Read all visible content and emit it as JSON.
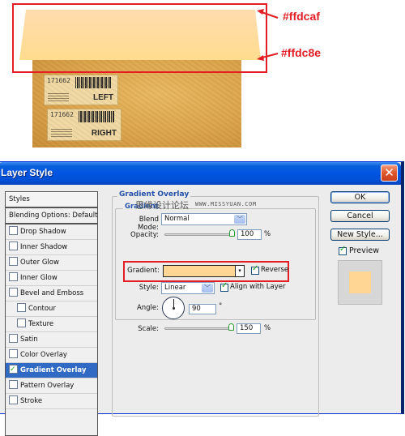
{
  "illustration": {
    "box_labels": {
      "left": {
        "code": "171662",
        "word": "LEFT"
      },
      "right": {
        "code": "171662",
        "word": "RIGHT"
      }
    },
    "annotations": [
      {
        "text": "#ffdcaf",
        "color": "#ffdcaf"
      },
      {
        "text": "#ffdc8e",
        "color": "#ffdc8e"
      }
    ],
    "highlight_color": "#e31e24"
  },
  "dialog": {
    "title": "Layer Style",
    "close_icon": "close-x-icon",
    "styles_panel": {
      "header": "Styles",
      "blending_options": "Blending Options: Default",
      "items": [
        {
          "label": "Drop Shadow",
          "checked": false,
          "indent": false,
          "selected": false
        },
        {
          "label": "Inner Shadow",
          "checked": false,
          "indent": false,
          "selected": false
        },
        {
          "label": "Outer Glow",
          "checked": false,
          "indent": false,
          "selected": false
        },
        {
          "label": "Inner Glow",
          "checked": false,
          "indent": false,
          "selected": false
        },
        {
          "label": "Bevel and Emboss",
          "checked": false,
          "indent": false,
          "selected": false
        },
        {
          "label": "Contour",
          "checked": false,
          "indent": true,
          "selected": false
        },
        {
          "label": "Texture",
          "checked": false,
          "indent": true,
          "selected": false
        },
        {
          "label": "Satin",
          "checked": false,
          "indent": false,
          "selected": false
        },
        {
          "label": "Color Overlay",
          "checked": false,
          "indent": false,
          "selected": false
        },
        {
          "label": "Gradient Overlay",
          "checked": true,
          "indent": false,
          "selected": true
        },
        {
          "label": "Pattern Overlay",
          "checked": false,
          "indent": false,
          "selected": false
        },
        {
          "label": "Stroke",
          "checked": false,
          "indent": false,
          "selected": false
        }
      ]
    },
    "gradient_overlay": {
      "group_title": "Gradient Overlay",
      "sub_title": "Gradient",
      "watermark": "思缘设计论坛",
      "watermark_url": "WWW.MISSYUAN.COM",
      "blend_mode_label": "Blend Mode:",
      "blend_mode_value": "Normal",
      "opacity_label": "Opacity:",
      "opacity_value": "100",
      "opacity_unit": "%",
      "opacity_fraction": 1.0,
      "gradient_label": "Gradient:",
      "gradient_color": "#ffd694",
      "reverse_label": "Reverse",
      "reverse_checked": true,
      "style_label": "Style:",
      "style_value": "Linear",
      "align_label": "Align with Layer",
      "align_checked": true,
      "angle_label": "Angle:",
      "angle_value": "90",
      "angle_unit": "°",
      "scale_label": "Scale:",
      "scale_value": "150",
      "scale_unit": "%"
    },
    "buttons": {
      "ok": "OK",
      "cancel": "Cancel",
      "new_style": "New Style..."
    },
    "preview": {
      "label": "Preview",
      "checked": true,
      "swatch_color": "#ffd694"
    }
  }
}
